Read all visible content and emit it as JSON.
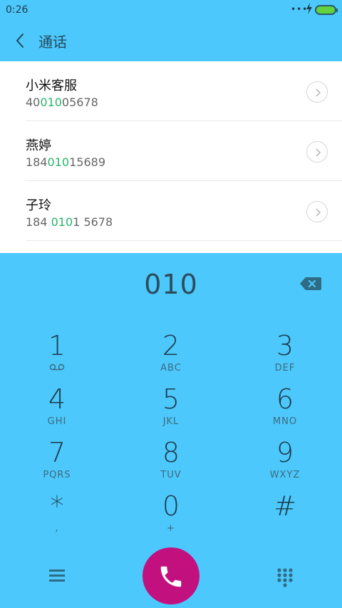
{
  "status_bar": {
    "time": "0:26",
    "dots": "•••"
  },
  "header": {
    "title": "通话"
  },
  "results": [
    {
      "name": "小米客服",
      "number_pre": "40",
      "number_match": "010",
      "number_post": "05678"
    },
    {
      "name": "燕婷",
      "number_pre": "184",
      "number_match": "010",
      "number_post": "15689"
    },
    {
      "name": "子玲",
      "number_pre": "184 ",
      "number_match": "010",
      "number_post": "1 5678"
    }
  ],
  "dialer": {
    "input": "010",
    "keys": [
      {
        "digit": "1",
        "letters": ""
      },
      {
        "digit": "2",
        "letters": "ABC"
      },
      {
        "digit": "3",
        "letters": "DEF"
      },
      {
        "digit": "4",
        "letters": "GHI"
      },
      {
        "digit": "5",
        "letters": "JKL"
      },
      {
        "digit": "6",
        "letters": "MNO"
      },
      {
        "digit": "7",
        "letters": "PQRS"
      },
      {
        "digit": "8",
        "letters": "TUV"
      },
      {
        "digit": "9",
        "letters": "WXYZ"
      },
      {
        "digit": "*",
        "letters": ","
      },
      {
        "digit": "0",
        "letters": "+"
      },
      {
        "digit": "#",
        "letters": ""
      }
    ]
  },
  "colors": {
    "accent": "#4cc8fc",
    "call": "#c2117f",
    "match": "#26b56b"
  }
}
